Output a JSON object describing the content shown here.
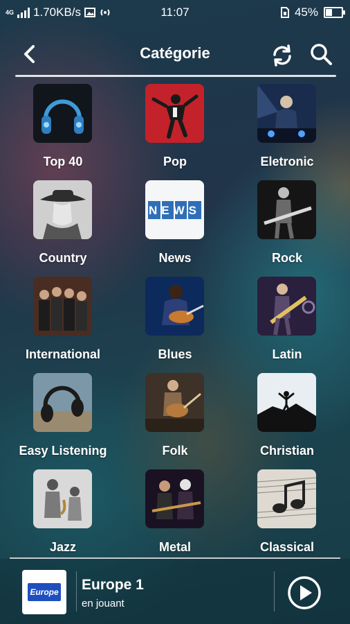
{
  "status_bar": {
    "network": "4G",
    "speed": "1.70KB/s",
    "time": "11:07",
    "battery": "45%",
    "battery_level": 0.45
  },
  "app_bar": {
    "title": "Catégorie"
  },
  "categories": [
    {
      "label": "Top 40"
    },
    {
      "label": "Pop"
    },
    {
      "label": "Eletronic"
    },
    {
      "label": "Country"
    },
    {
      "label": "News"
    },
    {
      "label": "Rock"
    },
    {
      "label": "International"
    },
    {
      "label": "Blues"
    },
    {
      "label": "Latin"
    },
    {
      "label": "Easy Listening"
    },
    {
      "label": "Folk"
    },
    {
      "label": "Christian"
    },
    {
      "label": "Jazz"
    },
    {
      "label": "Metal"
    },
    {
      "label": "Classical"
    }
  ],
  "news_thumb_text": "NEWS",
  "player": {
    "logo_text": "Europe 1",
    "station": "Europe 1",
    "status": "en jouant"
  },
  "colors": {
    "accent": "#ffffff",
    "logo_blue": "#1f4fbf"
  }
}
